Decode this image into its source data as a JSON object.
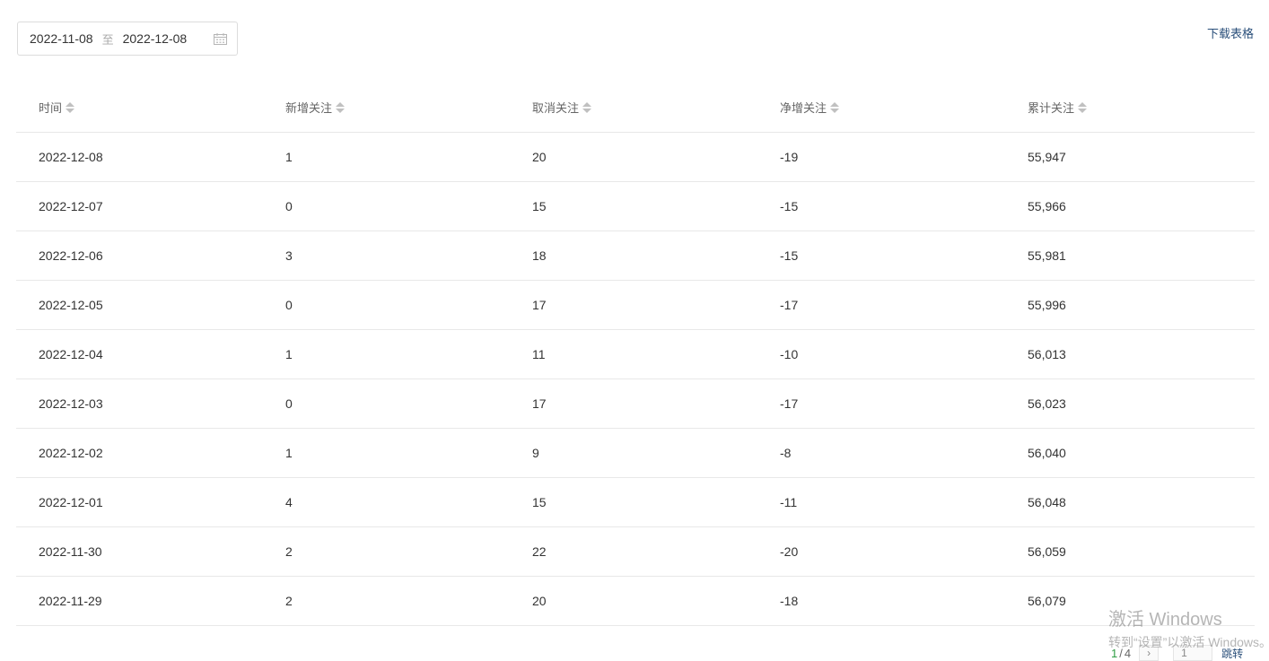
{
  "date_range": {
    "start": "2022-11-08",
    "separator": "至",
    "end": "2022-12-08"
  },
  "download_label": "下载表格",
  "table": {
    "columns": [
      "时间",
      "新增关注",
      "取消关注",
      "净增关注",
      "累计关注"
    ],
    "rows": [
      [
        "2022-12-08",
        "1",
        "20",
        "-19",
        "55,947"
      ],
      [
        "2022-12-07",
        "0",
        "15",
        "-15",
        "55,966"
      ],
      [
        "2022-12-06",
        "3",
        "18",
        "-15",
        "55,981"
      ],
      [
        "2022-12-05",
        "0",
        "17",
        "-17",
        "55,996"
      ],
      [
        "2022-12-04",
        "1",
        "11",
        "-10",
        "56,013"
      ],
      [
        "2022-12-03",
        "0",
        "17",
        "-17",
        "56,023"
      ],
      [
        "2022-12-02",
        "1",
        "9",
        "-8",
        "56,040"
      ],
      [
        "2022-12-01",
        "4",
        "15",
        "-11",
        "56,048"
      ],
      [
        "2022-11-30",
        "2",
        "22",
        "-20",
        "56,059"
      ],
      [
        "2022-11-29",
        "2",
        "20",
        "-18",
        "56,079"
      ]
    ]
  },
  "pagination": {
    "current": "1",
    "separator": "/",
    "total": "4",
    "next_symbol": "›",
    "jump_value": "1",
    "jump_label": "跳转"
  },
  "watermark": {
    "title": "激活 Windows",
    "subtitle": "转到“设置”以激活 Windows。"
  },
  "colors": {
    "link": "#2a4f7a",
    "current_page": "#2f9e44",
    "border": "#e8e8e8"
  }
}
